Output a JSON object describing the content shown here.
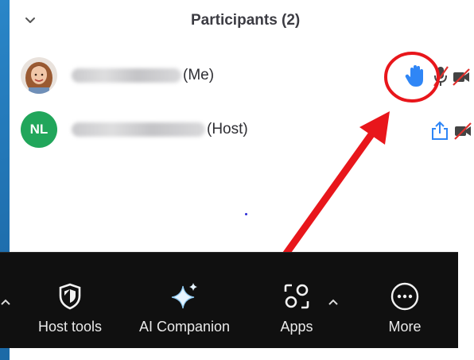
{
  "panel": {
    "title": "Participants (2)"
  },
  "participants": [
    {
      "role_label": "(Me)",
      "avatar": "photo",
      "hand_raised": true,
      "mic": "muted",
      "video": "off"
    },
    {
      "role_label": "(Host)",
      "initials": "NL",
      "avatar_color": "#21a65b",
      "sharing": true,
      "video": "off"
    }
  ],
  "icons": {
    "collapse": "chevron-down-icon",
    "raised_hand": "raised-hand-icon",
    "mic_muted": "microphone-muted-icon",
    "video_off": "video-off-icon",
    "share": "share-screen-icon"
  },
  "toolbar": {
    "items": [
      {
        "label": "Host tools",
        "icon": "shield-icon"
      },
      {
        "label": "AI Companion",
        "icon": "sparkle-icon"
      },
      {
        "label": "Apps",
        "icon": "apps-icon"
      },
      {
        "label": "More",
        "icon": "more-icon"
      }
    ]
  },
  "colors": {
    "accent_blue": "#2f86f6",
    "annotation_red": "#e8161b",
    "muted_red": "#e0312e",
    "toolbar_bg": "#101010",
    "host_avatar": "#21a65b"
  }
}
